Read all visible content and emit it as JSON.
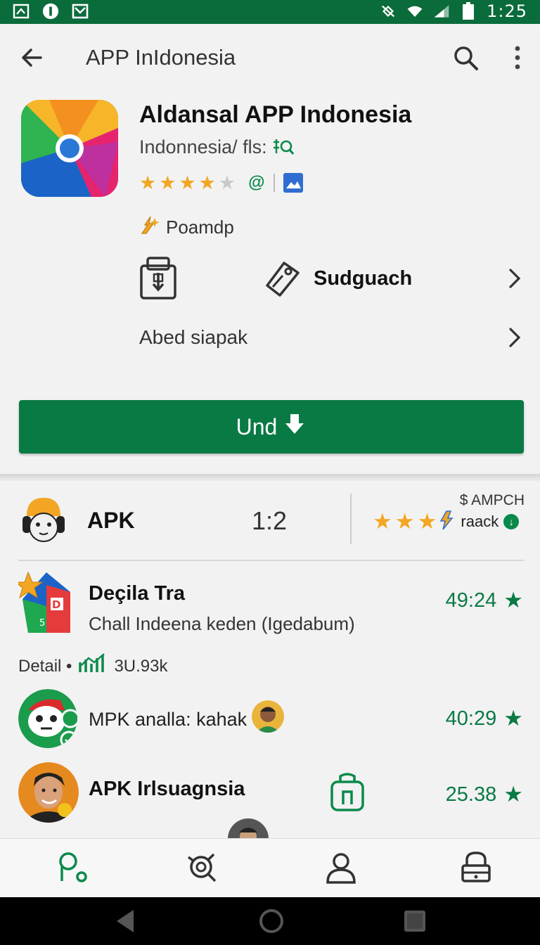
{
  "status_bar": {
    "time": "1:25"
  },
  "app_bar": {
    "title": "APP InIdonesia"
  },
  "app": {
    "title": "Aldansal APP Indonesia",
    "subtitle": "Indonnesia/ fls:",
    "rating_stars": 4,
    "promo_label": "Poamdp",
    "feature_label": "Sudguach",
    "about_label": "Abed siapak",
    "install_label": "Und"
  },
  "stats": {
    "label": "APK",
    "version": "1:2",
    "caption": "$ AMPCH",
    "stars": 3,
    "track_label": "raack"
  },
  "list": [
    {
      "name": "Deçila Tra",
      "desc": "Chall Indeena keden (Igedabum)",
      "score": "49:24"
    },
    {
      "name": "MPK analla: kahak",
      "desc": "",
      "score": "40:29"
    },
    {
      "name": "APK Irlsuagnsia",
      "desc": "",
      "score": "25.38"
    }
  ],
  "detail": {
    "label": "Detail •",
    "count": "3U.93k"
  },
  "colors": {
    "primary": "#0a7a45",
    "status_bar": "#0a6b3b",
    "star": "#f2a623"
  }
}
